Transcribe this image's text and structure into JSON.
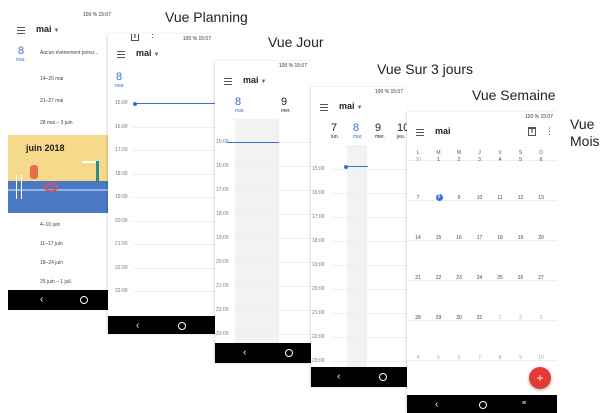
{
  "labels": {
    "planning": "Vue Planning",
    "jour": "Vue Jour",
    "trois_jours": "Vue Sur 3 jours",
    "semaine": "Vue Semaine",
    "mois": "Vue\nMois"
  },
  "status": {
    "battery": "100 %",
    "time": "15:07"
  },
  "month": "mai",
  "cal_icon_day": "8",
  "planning": {
    "day_num": "8",
    "day_name": "mar.",
    "no_event": "Aucun événement prévu...",
    "ranges": [
      "14–20 mai",
      "21–27 mai",
      "28 mai – 3 juin",
      "4–10 juin",
      "11–17 juin",
      "18–24 juin",
      "25 juin – 1 juil."
    ],
    "banner_title": "juin 2018"
  },
  "jour": {
    "day_num": "8",
    "day_name": "mar.",
    "next_num": "9",
    "next_name": "mer.",
    "hours": [
      "15:00",
      "16:00",
      "17:00",
      "18:00",
      "19:00",
      "20:00",
      "21:00",
      "22:00",
      "23:00"
    ]
  },
  "trois": {
    "days": [
      {
        "n": "8",
        "d": "mar."
      },
      {
        "n": "9",
        "d": "mer."
      }
    ],
    "hours": [
      "15:00",
      "16:00",
      "17:00",
      "18:00",
      "19:00",
      "20:00",
      "21:00",
      "22:00",
      "23:00"
    ]
  },
  "semaine": {
    "days": [
      {
        "n": "7",
        "d": "lun."
      },
      {
        "n": "8",
        "d": "mar."
      },
      {
        "n": "9",
        "d": "mer."
      },
      {
        "n": "10",
        "d": "jeu."
      }
    ],
    "hours": [
      "15:00",
      "16:00",
      "17:00",
      "18:00",
      "19:00",
      "20:00",
      "21:00",
      "22:00",
      "23:00"
    ]
  },
  "mois": {
    "headers": [
      "L",
      "M",
      "M",
      "J",
      "V",
      "S",
      "D"
    ],
    "weeks": [
      [
        "30",
        "1",
        "2",
        "3",
        "4",
        "5",
        "6"
      ],
      [
        "7",
        "8",
        "9",
        "10",
        "11",
        "12",
        "13"
      ],
      [
        "14",
        "15",
        "16",
        "17",
        "18",
        "19",
        "20"
      ],
      [
        "21",
        "22",
        "23",
        "24",
        "25",
        "26",
        "27"
      ],
      [
        "28",
        "29",
        "30",
        "31",
        "1",
        "2",
        "3"
      ],
      [
        "4",
        "5",
        "6",
        "7",
        "8",
        "9",
        "10"
      ]
    ],
    "fab": "+"
  },
  "colors": {
    "accent": "#3a6fd8",
    "fab": "#e53935"
  }
}
